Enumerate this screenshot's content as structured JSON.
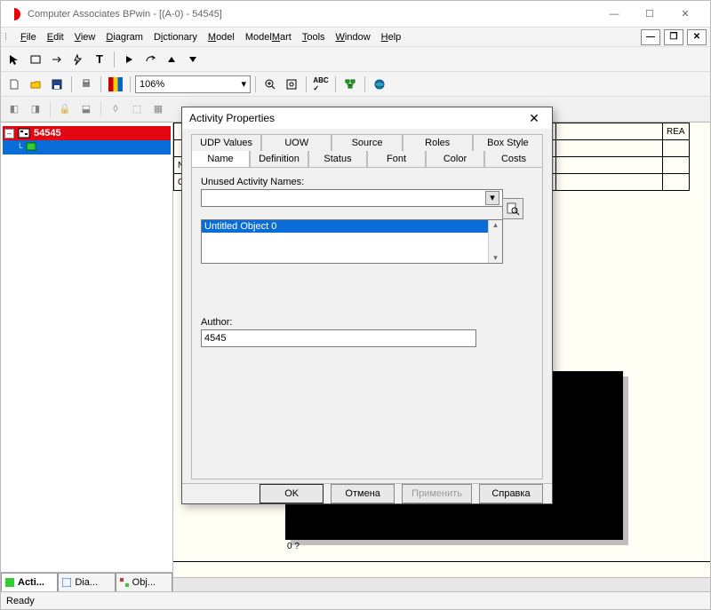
{
  "window": {
    "title": "Computer Associates BPwin - [(A-0)  - 54545]"
  },
  "menu": {
    "file": "File",
    "edit": "Edit",
    "view": "View",
    "diagram": "Diagram",
    "dictionary": "Dictionary",
    "model": "Model",
    "modelmart": "ModelMart",
    "tools": "Tools",
    "window": "Window",
    "help": "Help"
  },
  "toolbar": {
    "zoom": "106%"
  },
  "tree": {
    "root_label": "54545",
    "child_label": ""
  },
  "side_tabs": {
    "acti": "Acti...",
    "dia": "Dia...",
    "obj": "Obj..."
  },
  "canvas": {
    "col_rea": "REA",
    "row_nded": "NDED",
    "row_on": "ON",
    "box_label": "0 ?"
  },
  "dialog": {
    "title": "Activity Properties",
    "tabs_top": [
      "UDP Values",
      "UOW",
      "Source",
      "Roles",
      "Box Style"
    ],
    "tabs_bottom": [
      "Name",
      "Definition",
      "Status",
      "Font",
      "Color",
      "Costs"
    ],
    "unused_label": "Unused Activity Names:",
    "unused_value": "",
    "list_item": "Untitled Object 0",
    "author_label": "Author:",
    "author_value": "4545",
    "btn_ok": "OK",
    "btn_cancel": "Отмена",
    "btn_apply": "Применить",
    "btn_help": "Справка"
  },
  "status": {
    "text": "Ready"
  }
}
